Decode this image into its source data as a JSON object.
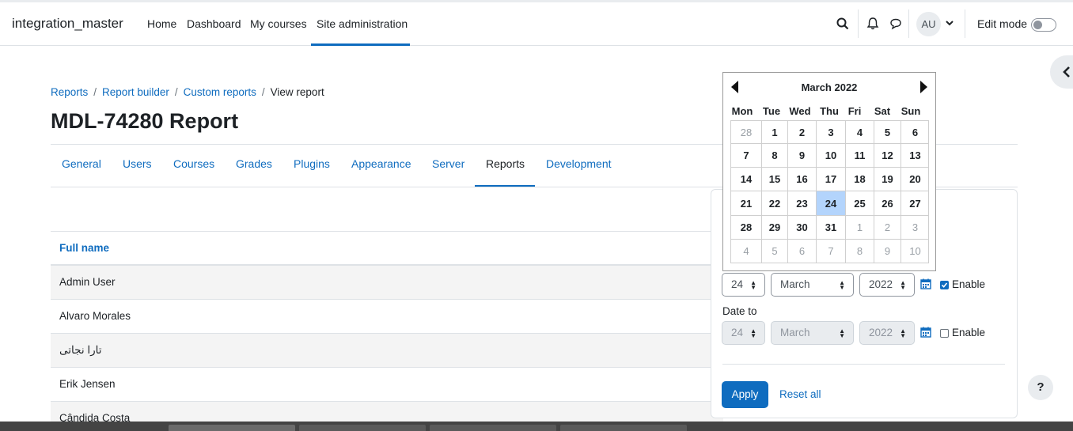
{
  "navbar": {
    "brand": "integration_master",
    "links": [
      "Home",
      "Dashboard",
      "My courses",
      "Site administration"
    ],
    "avatar_initials": "AU",
    "edit_mode_label": "Edit mode"
  },
  "breadcrumb": [
    "Reports",
    "Report builder",
    "Custom reports",
    "View report"
  ],
  "page_title": "MDL-74280 Report",
  "tabs": [
    "General",
    "Users",
    "Courses",
    "Grades",
    "Plugins",
    "Appearance",
    "Server",
    "Reports",
    "Development"
  ],
  "table": {
    "header": "Full name",
    "rows": [
      "Admin User",
      "Alvaro Morales",
      "تارا نجاتی",
      "Erik Jensen",
      "Cândida Costa"
    ]
  },
  "filter": {
    "from": {
      "day": "24",
      "month": "March",
      "year": "2022",
      "enable_label": "Enable",
      "enabled": true
    },
    "to_label": "Date to",
    "to": {
      "day": "24",
      "month": "March",
      "year": "2022",
      "enable_label": "Enable",
      "enabled": false
    },
    "apply_label": "Apply",
    "reset_label": "Reset all"
  },
  "calendar": {
    "title": "March 2022",
    "weekdays": [
      "Mon",
      "Tue",
      "Wed",
      "Thu",
      "Fri",
      "Sat",
      "Sun"
    ],
    "weeks": [
      [
        "28",
        "1",
        "2",
        "3",
        "4",
        "5",
        "6"
      ],
      [
        "7",
        "8",
        "9",
        "10",
        "11",
        "12",
        "13"
      ],
      [
        "14",
        "15",
        "16",
        "17",
        "18",
        "19",
        "20"
      ],
      [
        "21",
        "22",
        "23",
        "24",
        "25",
        "26",
        "27"
      ],
      [
        "28",
        "29",
        "30",
        "31",
        "1",
        "2",
        "3"
      ],
      [
        "4",
        "5",
        "6",
        "7",
        "8",
        "9",
        "10"
      ]
    ],
    "selected_day": "24"
  },
  "help_label": "?",
  "colors": {
    "primary": "#0f6cbf",
    "selected_day": "#b3d4fc"
  }
}
